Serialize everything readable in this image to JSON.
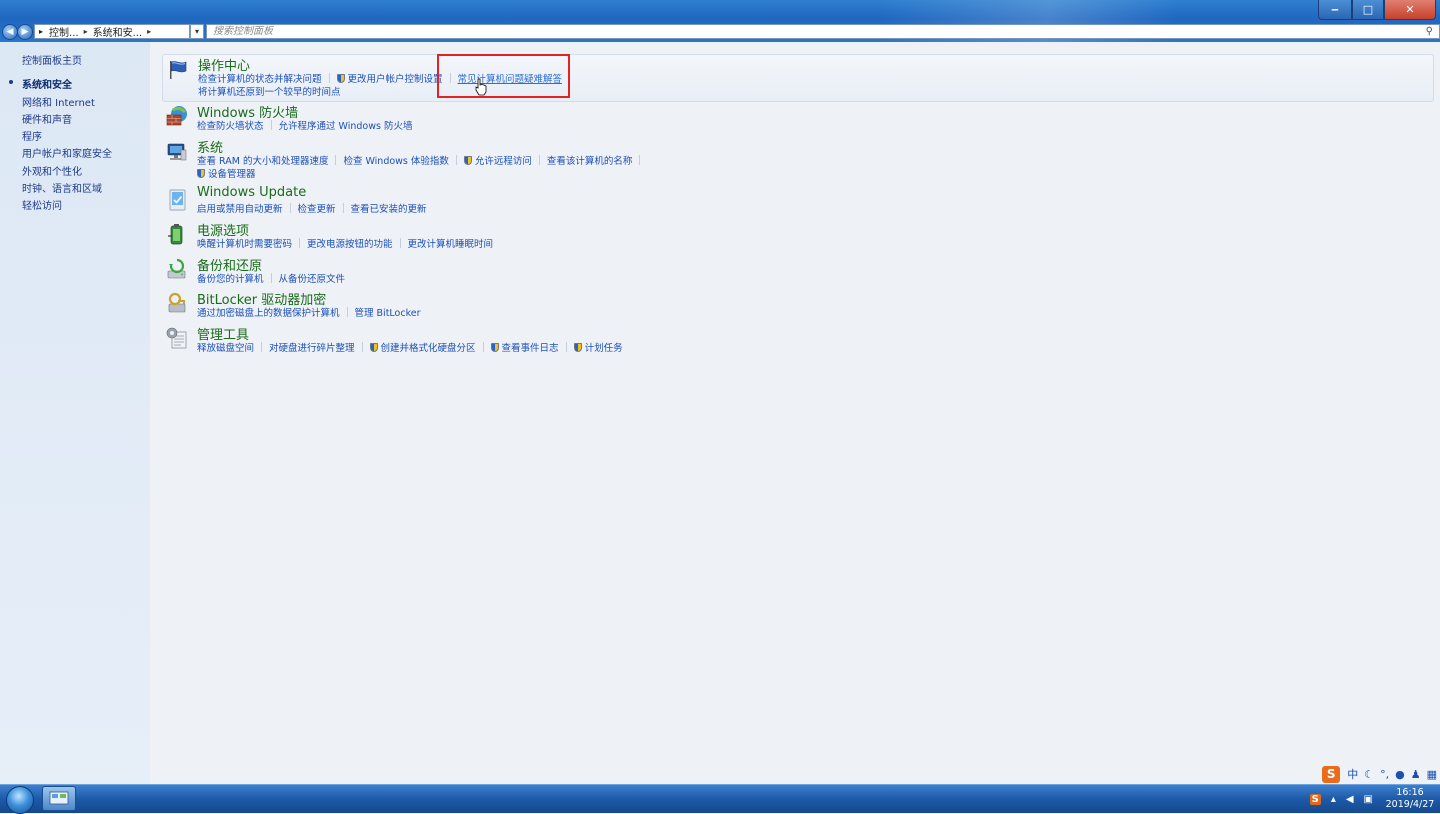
{
  "window": {
    "minimize_label": "‒",
    "maximize_label": "□",
    "close_label": "✕"
  },
  "address": {
    "crumb1": "控制...",
    "crumb2": "系统和安...",
    "sep": "▸"
  },
  "search": {
    "placeholder": "搜索控制面板"
  },
  "sidebar": {
    "home": "控制面板主页",
    "items": [
      {
        "label": "系统和安全",
        "active": true
      },
      {
        "label": "网络和 Internet"
      },
      {
        "label": "硬件和声音"
      },
      {
        "label": "程序"
      },
      {
        "label": "用户帐户和家庭安全"
      },
      {
        "label": "外观和个性化"
      },
      {
        "label": "时钟、语言和区域"
      },
      {
        "label": "轻松访问"
      }
    ]
  },
  "categories": {
    "action_center": {
      "title": "操作中心",
      "icon": "flag-icon",
      "links": [
        "检查计算机的状态并解决问题",
        "更改用户帐户控制设置",
        "常见计算机问题疑难解答",
        "将计算机还原到一个较早的时间点"
      ]
    },
    "firewall": {
      "title": "Windows 防火墙",
      "icon": "firewall-icon",
      "links": [
        "检查防火墙状态",
        "允许程序通过 Windows 防火墙"
      ]
    },
    "system": {
      "title": "系统",
      "icon": "computer-icon",
      "links": [
        "查看 RAM 的大小和处理器速度",
        "检查 Windows 体验指数",
        "允许远程访问",
        "查看该计算机的名称",
        "设备管理器"
      ]
    },
    "windows_update": {
      "title": "Windows Update",
      "icon": "windows-update-icon",
      "links": [
        "启用或禁用自动更新",
        "检查更新",
        "查看已安装的更新"
      ]
    },
    "power": {
      "title": "电源选项",
      "icon": "battery-icon",
      "links": [
        "唤醒计算机时需要密码",
        "更改电源按钮的功能",
        "更改计算机睡眠时间"
      ]
    },
    "backup": {
      "title": "备份和还原",
      "icon": "backup-icon",
      "links": [
        "备份您的计算机",
        "从备份还原文件"
      ]
    },
    "bitlocker": {
      "title": "BitLocker 驱动器加密",
      "icon": "bitlocker-key-icon",
      "links": [
        "通过加密磁盘上的数据保护计算机",
        "管理 BitLocker"
      ]
    },
    "admin_tools": {
      "title": "管理工具",
      "icon": "admin-tools-icon",
      "links": [
        "释放磁盘空间",
        "对硬盘进行碎片整理",
        "创建并格式化硬盘分区",
        "查看事件日志",
        "计划任务"
      ]
    }
  },
  "taskbar": {
    "ime_label": "中",
    "ime_logo": "S",
    "time": "16:16",
    "date": "2019/4/27"
  },
  "colors": {
    "title_green": "#1a6b1a",
    "link_blue": "#1c50b8",
    "highlight_red": "#e02424"
  }
}
